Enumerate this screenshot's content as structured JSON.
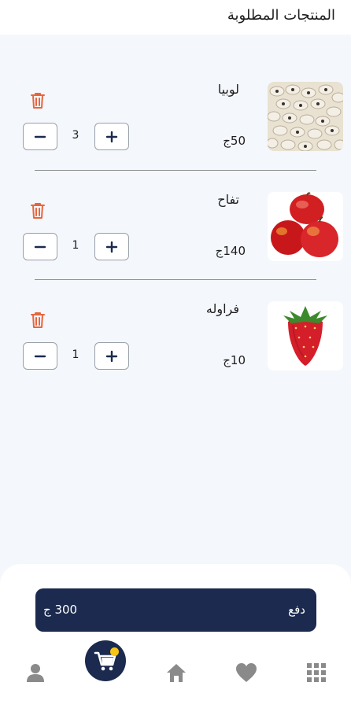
{
  "header": {
    "title": "المنتجات المطلوبة"
  },
  "cart": {
    "items": [
      {
        "name": "لوبيا",
        "price": "50ج",
        "quantity": "3",
        "image_icon": "black-eyed-peas"
      },
      {
        "name": "تفاح",
        "price": "140ج",
        "quantity": "1",
        "image_icon": "apples"
      },
      {
        "name": "فراوله",
        "price": "10ج",
        "quantity": "1",
        "image_icon": "strawberry"
      }
    ]
  },
  "checkout": {
    "pay_label": "دفع",
    "total": "300 ج"
  },
  "bottom_nav": {
    "items": [
      {
        "icon": "person-icon"
      },
      {
        "icon": "cart-icon",
        "active": true
      },
      {
        "icon": "home-icon"
      },
      {
        "icon": "heart-icon"
      },
      {
        "icon": "grid-icon"
      }
    ]
  },
  "colors": {
    "primary": "#1b2a4e",
    "delete": "#e8653c",
    "badge": "#f5c518",
    "background": "#f4f7fc"
  }
}
